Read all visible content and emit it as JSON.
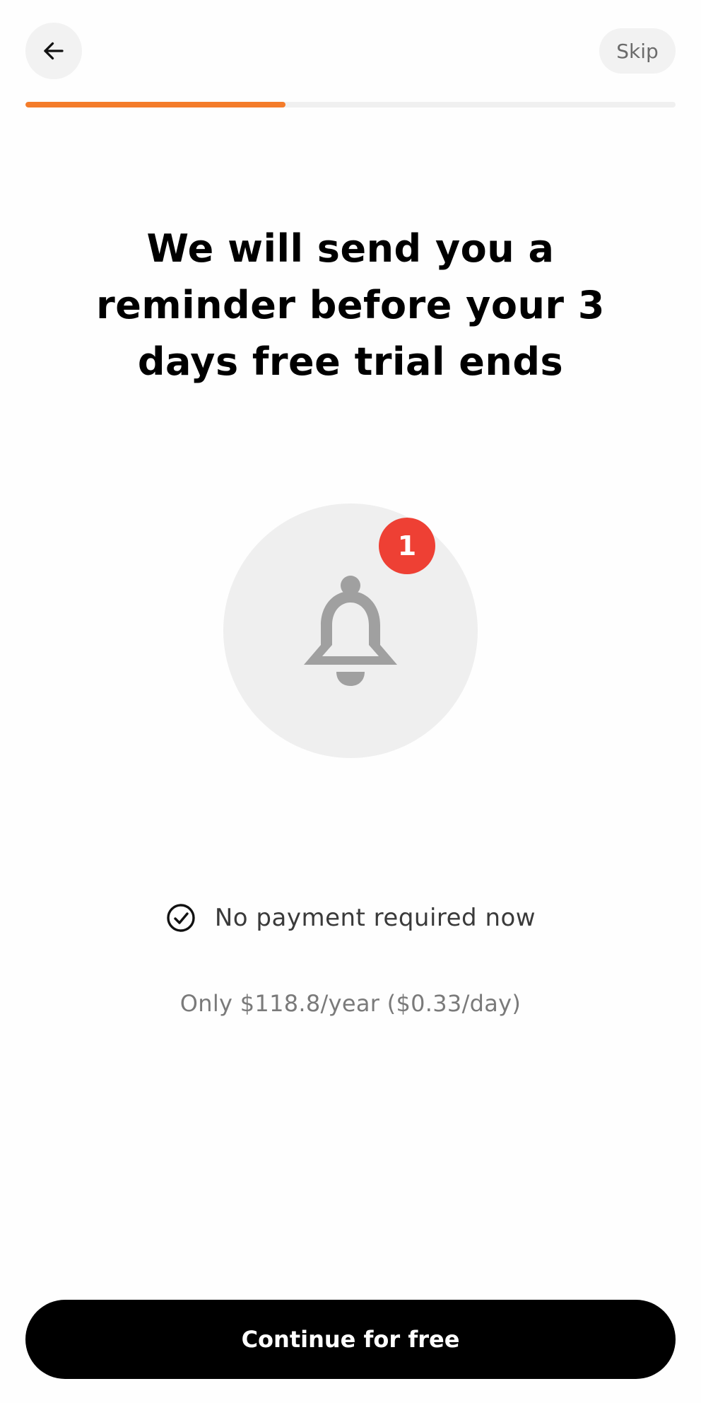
{
  "header": {
    "back_icon": "arrow-left-icon",
    "skip_label": "Skip"
  },
  "progress": {
    "fraction": 0.4,
    "fill_color": "#f47c2a",
    "track_color": "#f0f0f0"
  },
  "main": {
    "headline": "We will send you a reminder before your 3 days free trial ends",
    "bell_icon": "bell-icon",
    "badge_count": "1",
    "badge_color": "#ee4034",
    "feature_icon": "check-circle-icon",
    "feature_text": "No payment required now",
    "price_note": "Only $118.8/year ($0.33/day)"
  },
  "footer": {
    "cta_label": "Continue for free"
  }
}
